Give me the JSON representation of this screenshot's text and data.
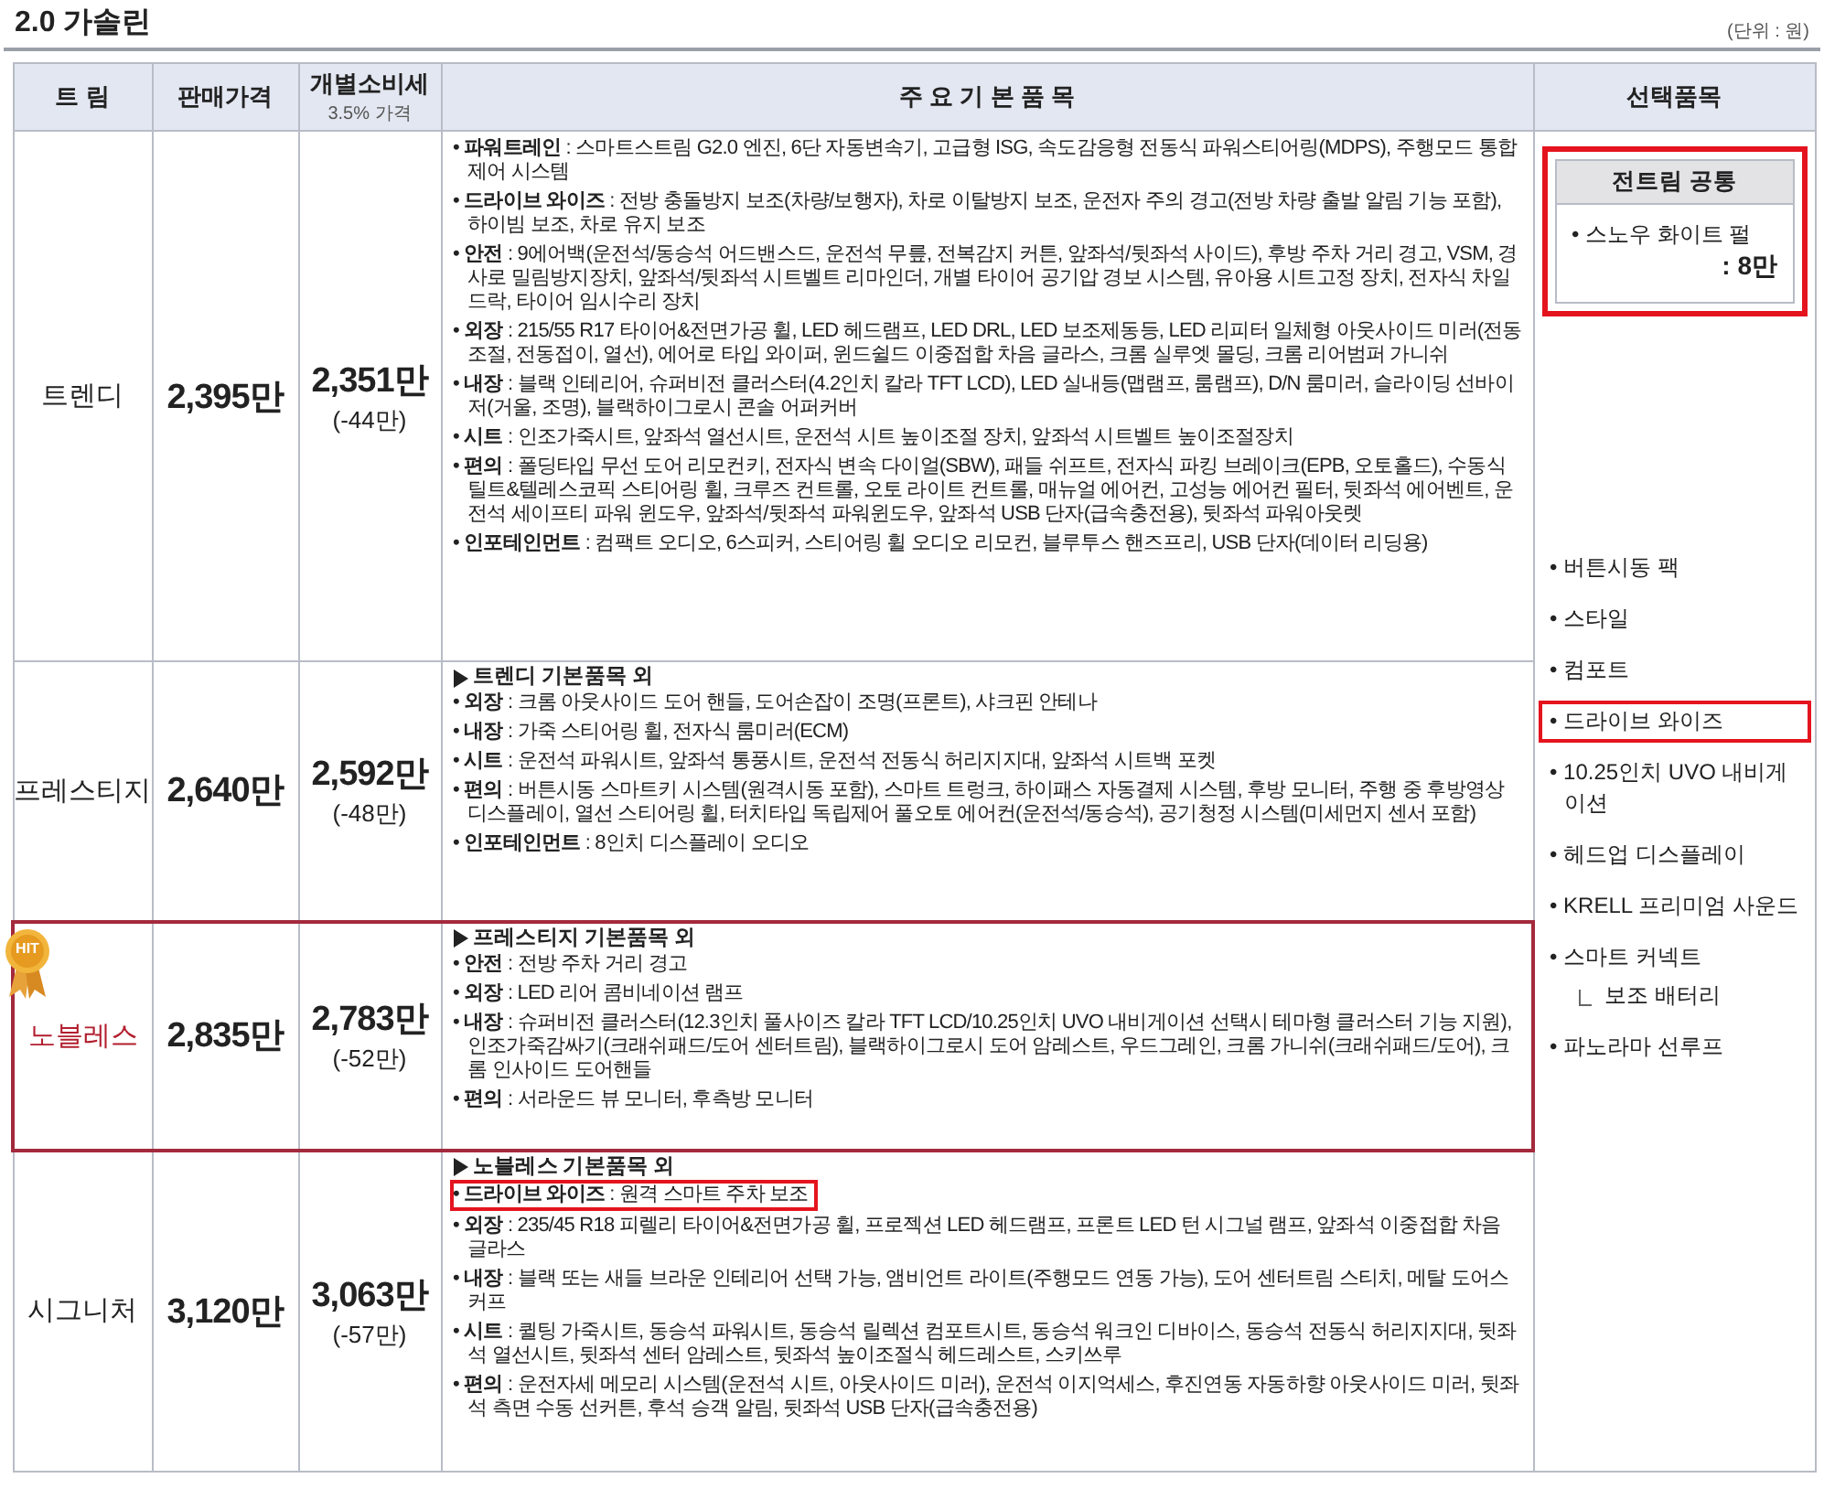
{
  "title": "2.0 가솔린",
  "unit": "(단위 : 원)",
  "columns": [
    {
      "label": "트 림"
    },
    {
      "label": "판매가격"
    },
    {
      "label": "개별소비세",
      "sub": "3.5% 가격"
    },
    {
      "label": "주 요 기 본 품 목"
    },
    {
      "label": "선택품목"
    }
  ],
  "trims": [
    {
      "name": "트렌디",
      "price": "2,395만",
      "tax_price": "2,351만",
      "tax_diff": "(-44만)",
      "hit": false,
      "features": [
        {
          "text": "• **파워트레인** : 스마트스트림 G2.0 엔진, 6단 자동변속기, 고급형 ISG, 속도감응형 전동식 파워스티어링(MDPS), 주행모드 통합제어 시스템",
          "highlighted": false
        },
        {
          "text": "• **드라이브 와이즈** : 전방 충돌방지 보조(차량/보행자), 차로 이탈방지 보조, 운전자 주의 경고(전방 차량 출발 알림 기능 포함), 하이빔 보조, 차로 유지 보조",
          "highlighted": false
        },
        {
          "text": "• **안전** : 9에어백(운전석/동승석 어드밴스드, 운전석 무릎, 전복감지 커튼, 앞좌석/뒷좌석 사이드), 후방 주차 거리 경고, VSM, 경사로 밀림방지장치, 앞좌석/뒷좌석 시트벨트 리마인더, 개별 타이어 공기압 경보 시스템, 유아용 시트고정 장치, 전자식 차일드락, 타이어 임시수리 장치",
          "highlighted": false
        },
        {
          "text": "• **외장** : 215/55 R17 타이어&전면가공 휠, LED 헤드램프, LED DRL, LED 보조제동등, LED 리피터 일체형 아웃사이드 미러(전동조절, 전동접이, 열선), 에어로 타입 와이퍼, 윈드쉴드 이중접합 차음 글라스, 크롬 실루엣 몰딩, 크롬 리어범퍼 가니쉬",
          "highlighted": false
        },
        {
          "text": "• **내장** : 블랙 인테리어, 슈퍼비전 클러스터(4.2인치 칼라 TFT LCD), LED 실내등(맵램프, 룸램프), D/N 룸미러, 슬라이딩 선바이저(거울, 조명), 블랙하이그로시 콘솔 어퍼커버",
          "highlighted": false
        },
        {
          "text": "• **시트** : 인조가죽시트, 앞좌석 열선시트, 운전석 시트 높이조절 장치, 앞좌석 시트벨트 높이조절장치",
          "highlighted": false
        },
        {
          "text": "• **편의** : 폴딩타입 무선 도어 리모컨키, 전자식 변속 다이얼(SBW), 패들 쉬프트, 전자식 파킹 브레이크(EPB, 오토홀드), 수동식 틸트&텔레스코픽 스티어링 휠, 크루즈 컨트롤, 오토 라이트 컨트롤, 매뉴얼 에어컨, 고성능 에어컨 필터, 뒷좌석 에어벤트, 운전석 세이프티 파워 윈도우, 앞좌석/뒷좌석 파워윈도우, 앞좌석 USB 단자(급속충전용), 뒷좌석 파워아웃렛",
          "highlighted": false
        },
        {
          "text": "• **인포테인먼트** : 컴팩트 오디오, 6스피커, 스티어링 휠 오디오 리모컨, 블루투스 핸즈프리, USB 단자(데이터 리딩용)",
          "highlighted": false
        }
      ]
    },
    {
      "name": "프레스티지",
      "price": "2,640만",
      "tax_price": "2,592만",
      "tax_diff": "(-48만)",
      "hit": false,
      "base": "트렌디 기본품목 외",
      "features": [
        {
          "text": "• **외장** : 크롬 아웃사이드 도어 핸들, 도어손잡이 조명(프론트), 샤크핀 안테나",
          "highlighted": false
        },
        {
          "text": "• **내장** : 가죽 스티어링 휠, 전자식 룸미러(ECM)",
          "highlighted": false
        },
        {
          "text": "• **시트** : 운전석 파워시트, 앞좌석 통풍시트, 운전석 전동식 허리지지대, 앞좌석 시트백 포켓",
          "highlighted": false
        },
        {
          "text": "• **편의** : 버튼시동 스마트키 시스템(원격시동 포함), 스마트 트렁크, 하이패스 자동결제 시스템, 후방 모니터, 주행 중 후방영상 디스플레이, 열선 스티어링 휠, 터치타입 독립제어 풀오토 에어컨(운전석/동승석), 공기청정 시스템(미세먼지 센서 포함)",
          "highlighted": false
        },
        {
          "text": "• **인포테인먼트** : 8인치 디스플레이 오디오",
          "highlighted": false
        }
      ]
    },
    {
      "name": "노블레스",
      "price": "2,835만",
      "tax_price": "2,783만",
      "tax_diff": "(-52만)",
      "hit": true,
      "badge": "HIT",
      "base": "프레스티지 기본품목 외",
      "features": [
        {
          "text": "• **안전** : 전방 주차 거리 경고",
          "highlighted": false
        },
        {
          "text": "• **외장** : LED 리어 콤비네이션 램프",
          "highlighted": false
        },
        {
          "text": "• **내장** : 슈퍼비전 클러스터(12.3인치 풀사이즈 칼라 TFT LCD/10.25인치 UVO 내비게이션 선택시 테마형 클러스터 기능 지원), 인조가죽감싸기(크래쉬패드/도어 센터트림), 블랙하이그로시 도어 암레스트, 우드그레인, 크롬 가니쉬(크래쉬패드/도어), 크롬 인사이드 도어핸들",
          "highlighted": false
        },
        {
          "text": "• **편의** : 서라운드 뷰 모니터, 후측방 모니터",
          "highlighted": false
        }
      ]
    },
    {
      "name": "시그니처",
      "price": "3,120만",
      "tax_price": "3,063만",
      "tax_diff": "(-57만)",
      "hit": false,
      "base": "노블레스 기본품목 외",
      "features": [
        {
          "text": "• **드라이브 와이즈** : 원격 스마트 주차 보조",
          "highlighted": true
        },
        {
          "text": "• **외장** : 235/45 R18 피렐리 타이어&전면가공 휠, 프로젝션 LED 헤드램프, 프론트 LED 턴 시그널 램프, 앞좌석 이중접합 차음 글라스",
          "highlighted": false
        },
        {
          "text": "• **내장** : 블랙 또는 새들 브라운 인테리어 선택 가능, 앰비언트 라이트(주행모드 연동 가능), 도어 센터트림 스티치, 메탈 도어스커프",
          "highlighted": false
        },
        {
          "text": "• **시트** : 퀼팅 가죽시트, 동승석 파워시트, 동승석 릴렉션 컴포트시트, 동승석 워크인 디바이스, 동승석 전동식 허리지지대, 뒷좌석 열선시트, 뒷좌석 센터 암레스트, 뒷좌석 높이조절식 헤드레스트, 스키쓰루",
          "highlighted": false
        },
        {
          "text": "• **편의** : 운전자세 메모리 시스템(운전석 시트, 아웃사이드 미러), 운전석 이지억세스, 후진연동 자동하향 아웃사이드 미러, 뒷좌석 측면 수동 선커튼, 후석 승객 알림, 뒷좌석 USB 단자(급속충전용)",
          "highlighted": false
        }
      ]
    }
  ],
  "common_options": {
    "title": "전트림 공통",
    "item": "• 스노우 화이트 펄",
    "price": ": 8만",
    "highlighted": true
  },
  "options": [
    {
      "label": "• 버튼시동 팩",
      "highlighted": false
    },
    {
      "label": "• 스타일",
      "highlighted": false
    },
    {
      "label": "• 컴포트",
      "highlighted": false
    },
    {
      "label": "• 드라이브 와이즈",
      "highlighted": true
    },
    {
      "label": "• 10.25인치 UVO 내비게이션",
      "highlighted": false
    },
    {
      "label": "• 헤드업 디스플레이",
      "highlighted": false
    },
    {
      "label": "• KRELL 프리미엄 사운드",
      "highlighted": false
    },
    {
      "label": "• 스마트 커넥트",
      "highlighted": false,
      "children": [
        {
          "label": "보조 배터리",
          "highlighted": false
        }
      ]
    },
    {
      "label": "• 파노라마 선루프",
      "highlighted": false
    }
  ]
}
